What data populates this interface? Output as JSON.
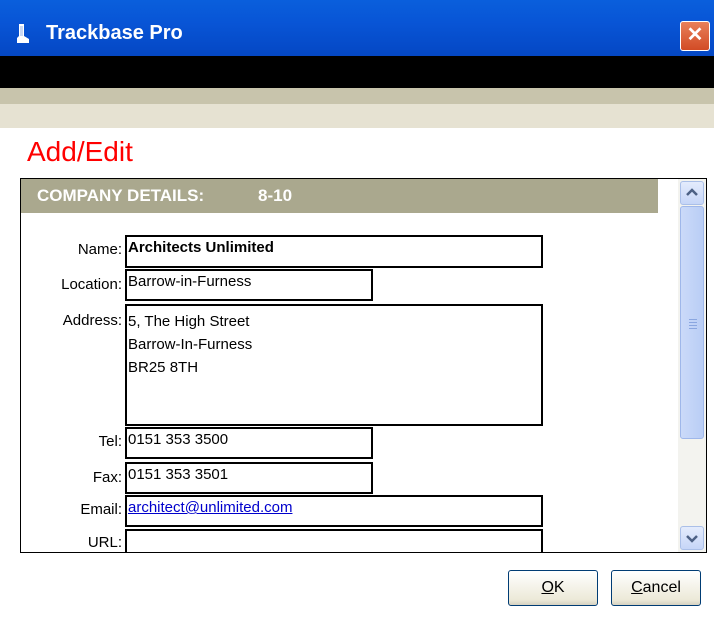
{
  "window": {
    "title": "Trackbase Pro",
    "close_glyph": "✕"
  },
  "page": {
    "heading": "Add/Edit"
  },
  "section": {
    "title": "COMPANY DETAILS:",
    "record_id": "8-10"
  },
  "form": {
    "name": {
      "label": "Name:",
      "value": "Architects Unlimited"
    },
    "location": {
      "label": "Location:",
      "value": "Barrow-in-Furness"
    },
    "address": {
      "label": "Address:",
      "lines": [
        "5, The High Street",
        "Barrow-In-Furness",
        "BR25 8TH"
      ]
    },
    "tel": {
      "label": "Tel:",
      "value": "0151 353 3500"
    },
    "fax": {
      "label": "Fax:",
      "value": "0151 353 3501"
    },
    "email": {
      "label": "Email:",
      "value": "architect@unlimited.com"
    },
    "url": {
      "label": "URL:",
      "value": ""
    }
  },
  "buttons": {
    "ok_mnemonic": "O",
    "ok_rest": "K",
    "cancel_mnemonic": "C",
    "cancel_rest": "ancel"
  },
  "colors": {
    "titlebar": "#0855d6",
    "heading": "#ff0000",
    "section_header": "#aaa88e",
    "link": "#0000cc"
  },
  "icons": {
    "app": "boot-icon",
    "close": "close-icon",
    "scroll_up": "chevron-up-icon",
    "scroll_down": "chevron-down-icon"
  }
}
